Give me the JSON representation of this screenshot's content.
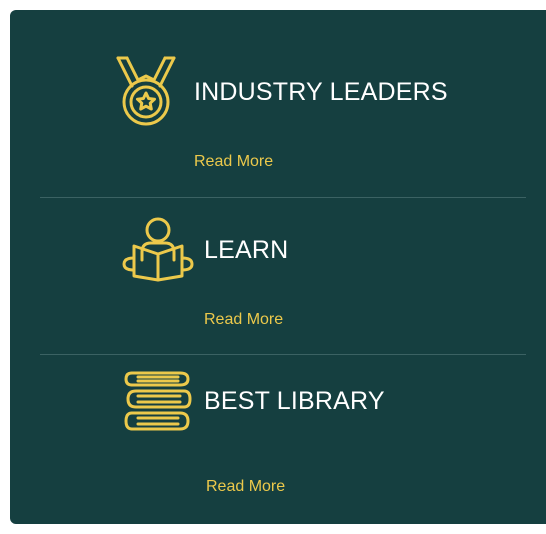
{
  "colors": {
    "panel_bg": "#153f40",
    "accent": "#ecc94b",
    "title_text": "#ffffff",
    "divider": "#3b6263"
  },
  "features": [
    {
      "icon": "medal-icon",
      "title": "INDUSTRY LEADERS",
      "link_label": "Read More"
    },
    {
      "icon": "reading-person-icon",
      "title": "LEARN",
      "link_label": "Read More"
    },
    {
      "icon": "books-stack-icon",
      "title": "BEST LIBRARY",
      "link_label": "Read More"
    }
  ]
}
